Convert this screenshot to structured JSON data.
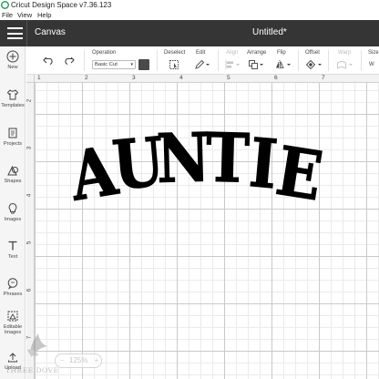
{
  "window": {
    "title": "Cricut Design Space  v7.36.123"
  },
  "menu": [
    "File",
    "View",
    "Help"
  ],
  "appbar": {
    "section": "Canvas",
    "document_title": "Untitled*"
  },
  "sidebar": {
    "items": [
      {
        "label": "New",
        "icon": "plus-circle-icon"
      },
      {
        "label": "Templates",
        "icon": "shirt-icon"
      },
      {
        "label": "Projects",
        "icon": "projects-icon"
      },
      {
        "label": "Shapes",
        "icon": "shapes-icon"
      },
      {
        "label": "Images",
        "icon": "lightbulb-icon"
      },
      {
        "label": "Text",
        "icon": "text-icon"
      },
      {
        "label": "Phrases",
        "icon": "speech-bubble-icon"
      },
      {
        "label": "Editable Images",
        "icon": "editable-image-icon"
      },
      {
        "label": "Upload",
        "icon": "upload-icon"
      }
    ]
  },
  "toolbar": {
    "operation_label": "Operation",
    "operation_value": "Basic Cut",
    "operation_color": "#4a4a4a",
    "deselect_label": "Deselect",
    "edit_label": "Edit",
    "align_label": "Align",
    "arrange_label": "Arrange",
    "flip_label": "Flip",
    "offset_label": "Offset",
    "warp_label": "Warp",
    "size_label": "Size",
    "size_w_label": "W"
  },
  "rulers": {
    "horizontal": [
      "1",
      "2",
      "3",
      "4",
      "5",
      "6",
      "7"
    ],
    "vertical": [
      "2",
      "3",
      "4",
      "5",
      "6",
      "7",
      "8",
      "9"
    ]
  },
  "design": {
    "text": "AUNTIE",
    "fill": "#000000"
  },
  "zoom": {
    "minus": "−",
    "value": "125%",
    "plus": "+"
  },
  "watermark": {
    "text": "THREE DOVE"
  }
}
